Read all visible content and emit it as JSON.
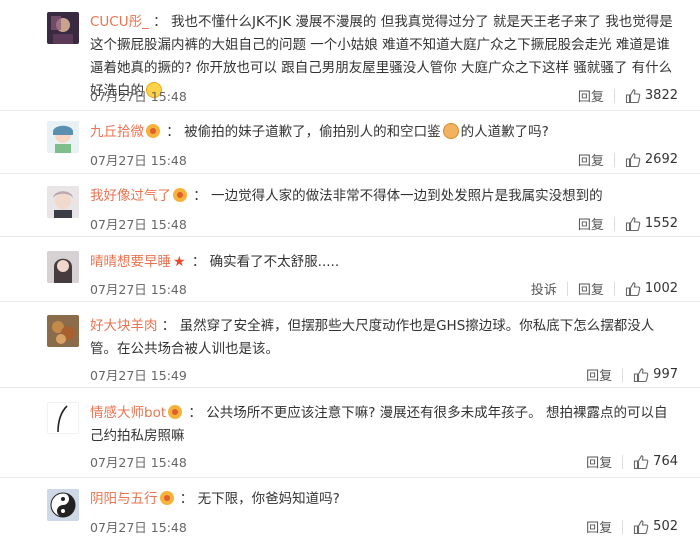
{
  "comments": [
    {
      "user": "CUCU彤_",
      "badge": "",
      "text_before": "我也不懂什么JK不JK 漫展不漫展的 但我真觉得过分了 就是天王老子来了 我也觉得是这个撅屁股漏内裤的大姐自己的问题 一个小姑娘 难道不知道大庭广众之下撅屁股会走光 难道是谁逼着她真的撅的? 你开放也可以 跟自己男朋友屋里骚没人管你 大庭广众之下这样 骚就骚了 有什么好洗白的",
      "text_after": "",
      "emoji": "smile",
      "time": "07月27日 15:48",
      "report": "",
      "reply": "回复",
      "likes": "3822"
    },
    {
      "user": "九丘拾微",
      "badge": "vip",
      "text_before": "被偷拍的妹子道歉了，偷拍别人的和空口鉴",
      "text_after": "的人道歉了吗?",
      "emoji": "fist",
      "time": "07月27日 15:48",
      "report": "",
      "reply": "回复",
      "likes": "2692"
    },
    {
      "user": "我好像过气了",
      "badge": "vip",
      "text_before": "一边觉得人家的做法非常不得体一边到处发照片是我属实没想到的",
      "text_after": "",
      "emoji": "",
      "time": "07月27日 15:48",
      "report": "",
      "reply": "回复",
      "likes": "1552"
    },
    {
      "user": "晴晴想要早睡",
      "badge": "star",
      "text_before": "确实看了不太舒服.....",
      "text_after": "",
      "emoji": "",
      "time": "07月27日 15:48",
      "report": "投诉",
      "reply": "回复",
      "likes": "1002"
    },
    {
      "user": "好大块羊肉",
      "badge": "",
      "text_before": "虽然穿了安全裤，但摆那些大尺度动作也是GHS擦边球。你私底下怎么摆都没人管。在公共场合被人训也是该。",
      "text_after": "",
      "emoji": "",
      "time": "07月27日 15:49",
      "report": "",
      "reply": "回复",
      "likes": "997"
    },
    {
      "user": "情感大师bot",
      "badge": "vip",
      "text_before": "公共场所不更应该注意下嘛? 漫展还有很多未成年孩子。 想拍裸露点的可以自己约拍私房照嘛",
      "text_after": "",
      "emoji": "",
      "time": "07月27日 15:48",
      "report": "",
      "reply": "回复",
      "likes": "764"
    },
    {
      "user": "阴阳与五行",
      "badge": "vip",
      "text_before": "无下限，你爸妈知道吗?",
      "text_after": "",
      "emoji": "",
      "time": "07月27日 15:48",
      "report": "",
      "reply": "回复",
      "likes": "502"
    }
  ]
}
